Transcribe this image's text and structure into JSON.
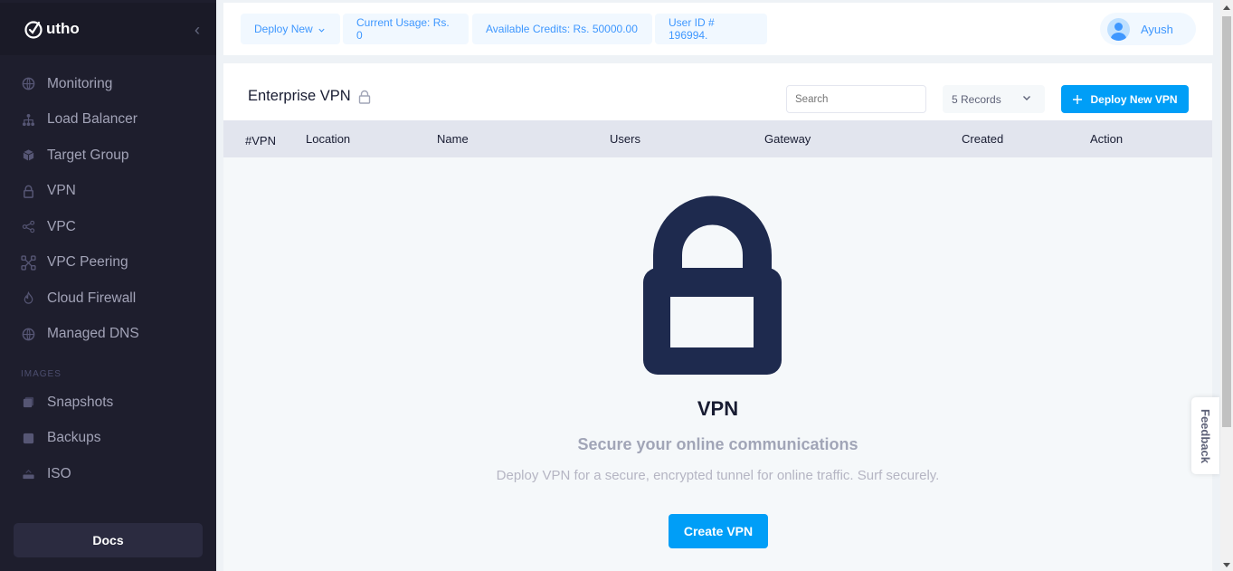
{
  "brand": {
    "logo_text": "utho"
  },
  "sidebar": {
    "items": [
      {
        "label": "Monitoring",
        "icon": "globe-icon"
      },
      {
        "label": "Load Balancer",
        "icon": "network-icon"
      },
      {
        "label": "Target Group",
        "icon": "cube-icon"
      },
      {
        "label": "VPN",
        "icon": "lock-icon"
      },
      {
        "label": "VPC",
        "icon": "share-icon"
      },
      {
        "label": "VPC Peering",
        "icon": "nodes-icon"
      },
      {
        "label": "Cloud Firewall",
        "icon": "fire-icon"
      },
      {
        "label": "Managed DNS",
        "icon": "globe-icon"
      }
    ],
    "section_images": "IMAGES",
    "image_items": [
      {
        "label": "Snapshots",
        "icon": "stack-icon"
      },
      {
        "label": "Backups",
        "icon": "archive-icon"
      },
      {
        "label": "ISO",
        "icon": "disc-icon"
      }
    ],
    "docs_label": "Docs"
  },
  "topbar": {
    "deploy_new": "Deploy New",
    "current_usage": "Current Usage: Rs. 0",
    "available_credits": "Available Credits: Rs. 50000.00",
    "user_id": "User ID # 196994.",
    "user_name": "Ayush"
  },
  "card": {
    "title": "Enterprise VPN",
    "search_placeholder": "Search",
    "records": "5 Records",
    "deploy_button": "Deploy New VPN",
    "columns": [
      "#VPN",
      "Location",
      "Name",
      "Users",
      "Gateway",
      "Created",
      "Action"
    ]
  },
  "empty_state": {
    "title": "VPN",
    "subtitle": "Secure your online communications",
    "description": "Deploy VPN for a secure, encrypted tunnel for online traffic. Surf securely.",
    "button": "Create VPN"
  },
  "feedback": "Feedback",
  "colors": {
    "accent": "#009ef7",
    "sidebar": "#1e1e2d",
    "lock": "#1e2a4e"
  }
}
